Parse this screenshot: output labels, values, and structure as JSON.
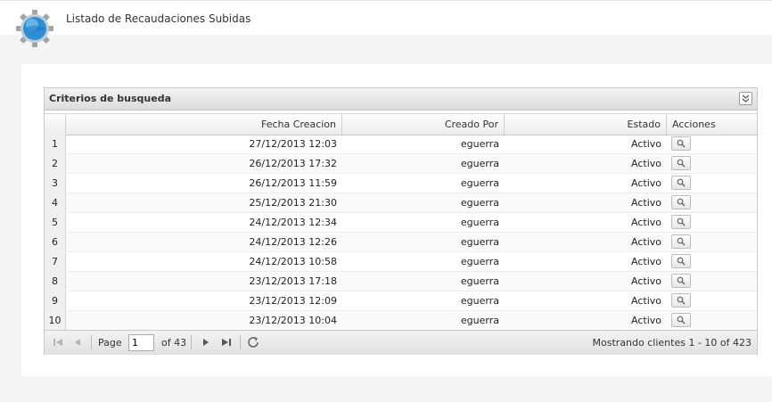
{
  "header": {
    "title": "Listado de Recaudaciones Subidas"
  },
  "panel": {
    "title": "Criterios de busqueda",
    "columns": {
      "fecha": "Fecha Creacion",
      "creado": "Creado Por",
      "estado": "Estado",
      "acciones": "Acciones"
    },
    "rows": [
      {
        "num": "1",
        "fecha": "27/12/2013 12:03",
        "creado": "eguerra",
        "estado": "Activo"
      },
      {
        "num": "2",
        "fecha": "26/12/2013 17:32",
        "creado": "eguerra",
        "estado": "Activo"
      },
      {
        "num": "3",
        "fecha": "26/12/2013 11:59",
        "creado": "eguerra",
        "estado": "Activo"
      },
      {
        "num": "4",
        "fecha": "25/12/2013 21:30",
        "creado": "eguerra",
        "estado": "Activo"
      },
      {
        "num": "5",
        "fecha": "24/12/2013 12:34",
        "creado": "eguerra",
        "estado": "Activo"
      },
      {
        "num": "6",
        "fecha": "24/12/2013 12:26",
        "creado": "eguerra",
        "estado": "Activo"
      },
      {
        "num": "7",
        "fecha": "24/12/2013 10:58",
        "creado": "eguerra",
        "estado": "Activo"
      },
      {
        "num": "8",
        "fecha": "23/12/2013 17:18",
        "creado": "eguerra",
        "estado": "Activo"
      },
      {
        "num": "9",
        "fecha": "23/12/2013 12:09",
        "creado": "eguerra",
        "estado": "Activo"
      },
      {
        "num": "10",
        "fecha": "23/12/2013 10:04",
        "creado": "eguerra",
        "estado": "Activo"
      }
    ]
  },
  "pager": {
    "page_label": "Page",
    "page_value": "1",
    "of_label": "of 43",
    "status": "Mostrando clientes 1 - 10 of 423"
  },
  "icons": {
    "logo": "globe-gear-icon",
    "collapse": "double-chevron-down-icon",
    "view": "magnifier-icon",
    "first": "first-page-icon",
    "prev": "prev-page-icon",
    "next": "next-page-icon",
    "last": "last-page-icon",
    "refresh": "refresh-icon"
  }
}
